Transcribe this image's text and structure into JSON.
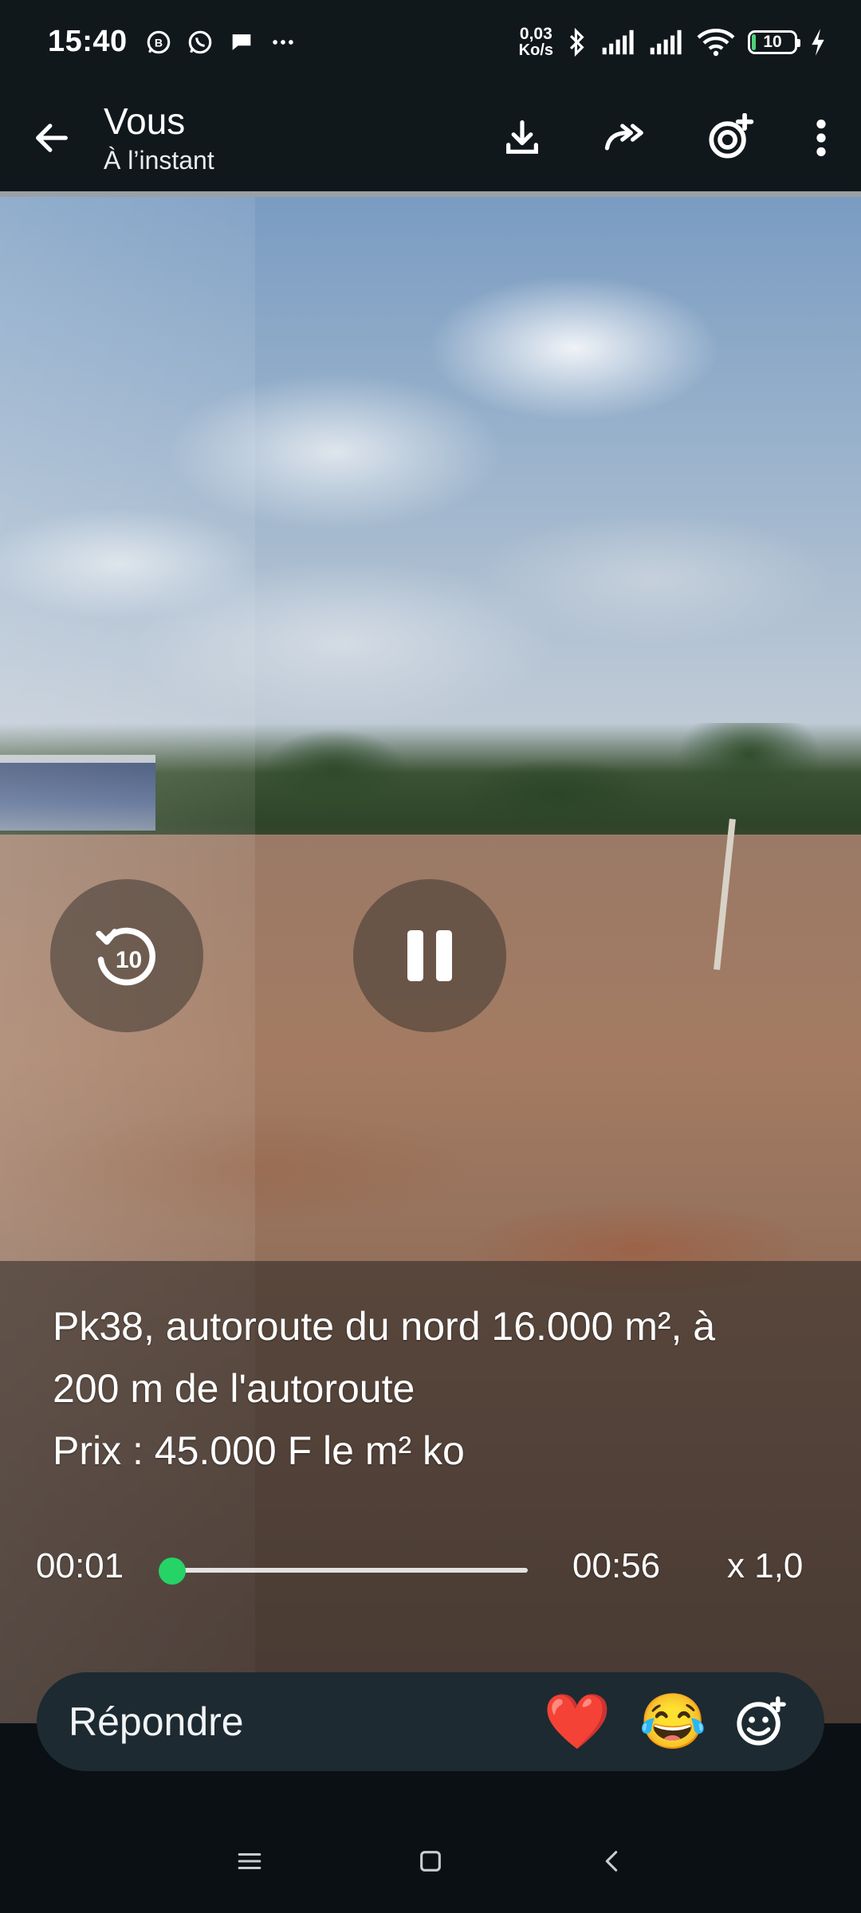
{
  "status_bar": {
    "time": "15:40",
    "net_speed_value": "0,03",
    "net_speed_unit": "Ko/s",
    "battery_level": "10",
    "left_icons": [
      "whatsapp-business-icon",
      "whatsapp-icon",
      "chat-bubble-icon",
      "more-dots-icon"
    ],
    "right_icons": [
      "bluetooth-icon",
      "signal-icon",
      "signal-icon",
      "wifi-icon",
      "battery-icon",
      "charging-icon"
    ]
  },
  "header": {
    "title": "Vous",
    "subtitle": "À l’instant",
    "actions": [
      "download-icon",
      "forward-icon",
      "camera-add-icon",
      "more-vert-icon"
    ]
  },
  "player": {
    "caption_lines": [
      "Pk38, autoroute du nord 16.000 m², à",
      "200 m de l'autoroute",
      "Prix : 45.000 F le m² ko"
    ],
    "current_time": "00:01",
    "total_time": "00:56",
    "speed": "x 1,0",
    "progress": 0.02,
    "rewind_seconds": "10",
    "accent_color": "#25d366"
  },
  "reply_bar": {
    "placeholder": "Répondre",
    "reactions": [
      "❤️",
      "😂"
    ]
  }
}
